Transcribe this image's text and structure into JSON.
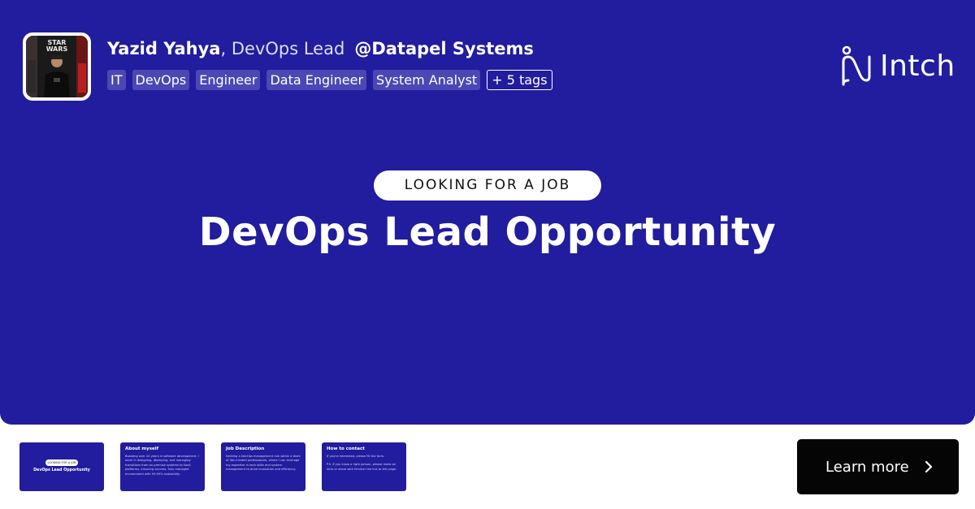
{
  "author": {
    "name": "Yazid Yahya",
    "separator": ",",
    "role": "DevOps Lead",
    "company": "@Datapel Systems"
  },
  "tags": [
    "IT",
    "DevOps",
    "Engineer",
    "Data Engineer",
    "System Analyst"
  ],
  "more_tags_label": "+ 5 tags",
  "brand": {
    "name": "Intch"
  },
  "status": "LOOKING FOR A JOB",
  "headline": "DevOps Lead Opportunity",
  "thumbnails": [
    {
      "pill": "LOOKING FOR A JOB",
      "headline": "DevOps Lead Opportunity"
    },
    {
      "title": "About myself",
      "body": "Boasting over 20 years in software development, I excel in designing, deploying, and managing transitions from on-premise systems to SaaS platforms, ensuring success, fully managed environment with 99.99% availability."
    },
    {
      "title": "Job Description",
      "body": "Seeking a DevOps management role within a team of like-minded professionals, where I can leverage my expertise in tech skills and system management to drive innovation and efficiency."
    },
    {
      "title": "How to contact",
      "body": "If you're interested, please fill the form.",
      "body2": "P.S. If you know a right person, please make an intro or share with him/her the link to this page."
    }
  ],
  "cta": {
    "label": "Learn more"
  },
  "colors": {
    "background": "#221c9e",
    "tag": "#4b47b4",
    "button": "#050505"
  },
  "icons": {
    "brand_logo": "intch-logo",
    "cta_arrow": "chevron-right-icon"
  }
}
